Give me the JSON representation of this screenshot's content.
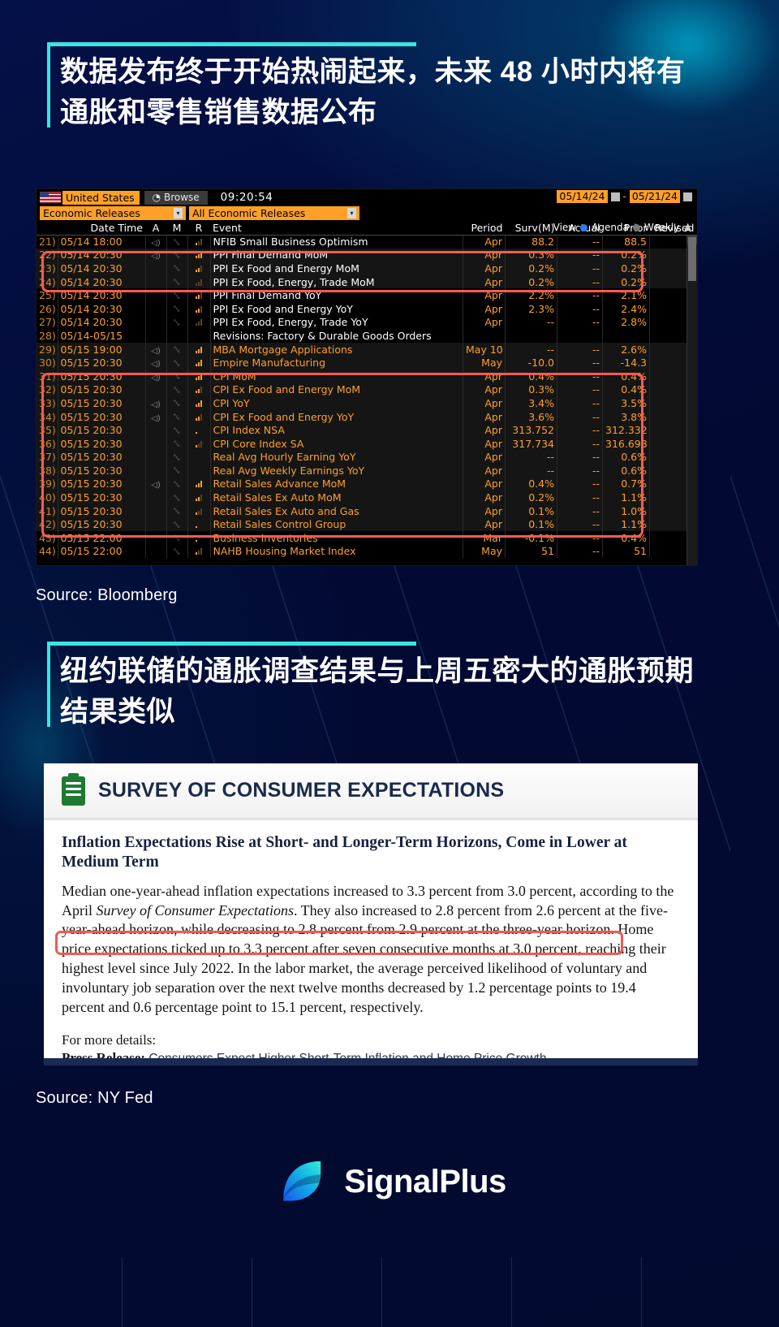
{
  "headlines": {
    "first": "数据发布终于开始热闹起来，未来 48 小时内将有通胀和零售销售数据公布",
    "second": "纽约联储的通胀调查结果与上周五密大的通胀预期结果类似"
  },
  "sources": {
    "first": "Source: Bloomberg",
    "second": "Source: NY Fed"
  },
  "bloomberg": {
    "country": "United States",
    "browse_label": "Browse",
    "clock": "09:20:54",
    "select_left": "Economic Releases",
    "select_right": "All Economic Releases",
    "date_from": "05/14/24",
    "date_to": "05/21/24",
    "date_separator": "-",
    "view_label": "View",
    "agenda_label": "Agenda",
    "weekly_label": "Weekly",
    "columns": {
      "date_time": "Date Time",
      "a": "A",
      "m": "M",
      "r": "R",
      "event": "Event",
      "period": "Period",
      "survey": "Surv(M)",
      "actual": "Actual",
      "prior": "Prior",
      "revised": "Revised"
    },
    "rows": [
      {
        "idx": "21)",
        "dt": "05/14 18:00",
        "a": true,
        "m": true,
        "r": "l1",
        "event": "NFIB Small Business Optimism",
        "color": "white",
        "period": "Apr",
        "surv": "88.2",
        "actual": "--",
        "prior": "88.5",
        "revised": "--",
        "alt": false
      },
      {
        "idx": "22)",
        "dt": "05/14 20:30",
        "a": true,
        "m": true,
        "r": "l3",
        "event": "PPI Final Demand MoM",
        "color": "white",
        "period": "Apr",
        "surv": "0.3%",
        "actual": "--",
        "prior": "0.2%",
        "revised": "--",
        "alt": true
      },
      {
        "idx": "23)",
        "dt": "05/14 20:30",
        "a": false,
        "m": true,
        "r": "l2",
        "event": "PPI Ex Food and Energy MoM",
        "color": "white",
        "period": "Apr",
        "surv": "0.2%",
        "actual": "--",
        "prior": "0.2%",
        "revised": "--",
        "alt": true
      },
      {
        "idx": "24)",
        "dt": "05/14 20:30",
        "a": false,
        "m": true,
        "r": "l0",
        "event": "PPI Ex Food, Energy, Trade MoM",
        "color": "white",
        "period": "Apr",
        "surv": "0.2%",
        "actual": "--",
        "prior": "0.2%",
        "revised": "--",
        "alt": true
      },
      {
        "idx": "25)",
        "dt": "05/14 20:30",
        "a": false,
        "m": true,
        "r": "l2",
        "event": "PPI Final Demand YoY",
        "color": "white",
        "period": "Apr",
        "surv": "2.2%",
        "actual": "--",
        "prior": "2.1%",
        "revised": "--",
        "alt": false
      },
      {
        "idx": "26)",
        "dt": "05/14 20:30",
        "a": false,
        "m": true,
        "r": "l2",
        "event": "PPI Ex Food and Energy YoY",
        "color": "white",
        "period": "Apr",
        "surv": "2.3%",
        "actual": "--",
        "prior": "2.4%",
        "revised": "--",
        "alt": false
      },
      {
        "idx": "27)",
        "dt": "05/14 20:30",
        "a": false,
        "m": true,
        "r": "l0",
        "event": "PPI Ex Food, Energy, Trade YoY",
        "color": "white",
        "period": "Apr",
        "surv": "--",
        "actual": "--",
        "prior": "2.8%",
        "revised": "--",
        "alt": false
      },
      {
        "idx": "28)",
        "dt": "05/14-05/15",
        "a": false,
        "m": false,
        "r": "",
        "event": "Revisions: Factory & Durable Goods Orders",
        "color": "white",
        "period": "",
        "surv": "",
        "actual": "",
        "prior": "",
        "revised": "",
        "alt": false
      },
      {
        "idx": "29)",
        "dt": "05/15 19:00",
        "a": true,
        "m": true,
        "r": "l3",
        "event": "MBA Mortgage Applications",
        "color": "orange",
        "period": "May 10",
        "surv": "--",
        "actual": "--",
        "prior": "2.6%",
        "revised": "--",
        "alt": true
      },
      {
        "idx": "30)",
        "dt": "05/15 20:30",
        "a": true,
        "m": true,
        "r": "l3",
        "event": "Empire Manufacturing",
        "color": "orange",
        "period": "May",
        "surv": "-10.0",
        "actual": "--",
        "prior": "-14.3",
        "revised": "--",
        "alt": true
      },
      {
        "idx": "31)",
        "dt": "05/15 20:30",
        "a": true,
        "m": true,
        "r": "l3",
        "event": "CPI MoM",
        "color": "orange",
        "period": "Apr",
        "surv": "0.4%",
        "actual": "--",
        "prior": "0.4%",
        "revised": "--",
        "alt": true
      },
      {
        "idx": "32)",
        "dt": "05/15 20:30",
        "a": false,
        "m": true,
        "r": "l2",
        "event": "CPI Ex Food and Energy MoM",
        "color": "orange",
        "period": "Apr",
        "surv": "0.3%",
        "actual": "--",
        "prior": "0.4%",
        "revised": "--",
        "alt": true
      },
      {
        "idx": "33)",
        "dt": "05/15 20:30",
        "a": true,
        "m": true,
        "r": "l3",
        "event": "CPI YoY",
        "color": "orange",
        "period": "Apr",
        "surv": "3.4%",
        "actual": "--",
        "prior": "3.5%",
        "revised": "--",
        "alt": true
      },
      {
        "idx": "34)",
        "dt": "05/15 20:30",
        "a": true,
        "m": true,
        "r": "l2",
        "event": "CPI Ex Food and Energy YoY",
        "color": "orange",
        "period": "Apr",
        "surv": "3.6%",
        "actual": "--",
        "prior": "3.8%",
        "revised": "--",
        "alt": true
      },
      {
        "idx": "35)",
        "dt": "05/15 20:30",
        "a": false,
        "m": true,
        "r": "dot",
        "event": "CPI Index NSA",
        "color": "orange",
        "period": "Apr",
        "surv": "313.752",
        "actual": "--",
        "prior": "312.332",
        "revised": "--",
        "alt": true
      },
      {
        "idx": "36)",
        "dt": "05/15 20:30",
        "a": false,
        "m": true,
        "r": "l1",
        "event": "CPI Core Index SA",
        "color": "orange",
        "period": "Apr",
        "surv": "317.734",
        "actual": "--",
        "prior": "316.698",
        "revised": "--",
        "alt": true
      },
      {
        "idx": "37)",
        "dt": "05/15 20:30",
        "a": false,
        "m": true,
        "r": "",
        "event": "Real Avg Hourly Earning YoY",
        "color": "orange",
        "period": "Apr",
        "surv": "--",
        "actual": "--",
        "prior": "0.6%",
        "revised": "--",
        "alt": true
      },
      {
        "idx": "38)",
        "dt": "05/15 20:30",
        "a": false,
        "m": true,
        "r": "",
        "event": "Real Avg Weekly Earnings YoY",
        "color": "orange",
        "period": "Apr",
        "surv": "--",
        "actual": "--",
        "prior": "0.6%",
        "revised": "--",
        "alt": true
      },
      {
        "idx": "39)",
        "dt": "05/15 20:30",
        "a": true,
        "m": true,
        "r": "l3",
        "event": "Retail Sales Advance MoM",
        "color": "orange",
        "period": "Apr",
        "surv": "0.4%",
        "actual": "--",
        "prior": "0.7%",
        "revised": "--",
        "alt": true
      },
      {
        "idx": "40)",
        "dt": "05/15 20:30",
        "a": false,
        "m": true,
        "r": "l2",
        "event": "Retail Sales Ex Auto MoM",
        "color": "orange",
        "period": "Apr",
        "surv": "0.2%",
        "actual": "--",
        "prior": "1.1%",
        "revised": "--",
        "alt": true
      },
      {
        "idx": "41)",
        "dt": "05/15 20:30",
        "a": false,
        "m": true,
        "r": "l1",
        "event": "Retail Sales Ex Auto and Gas",
        "color": "orange",
        "period": "Apr",
        "surv": "0.1%",
        "actual": "--",
        "prior": "1.0%",
        "revised": "--",
        "alt": true
      },
      {
        "idx": "42)",
        "dt": "05/15 20:30",
        "a": false,
        "m": true,
        "r": "dot",
        "event": "Retail Sales Control Group",
        "color": "orange",
        "period": "Apr",
        "surv": "0.1%",
        "actual": "--",
        "prior": "1.1%",
        "revised": "--",
        "alt": true
      },
      {
        "idx": "43)",
        "dt": "05/15 22:00",
        "a": false,
        "m": true,
        "r": "dot",
        "event": "Business Inventories",
        "color": "orange",
        "period": "Mar",
        "surv": "-0.1%",
        "actual": "--",
        "prior": "0.4%",
        "revised": "--",
        "alt": false
      },
      {
        "idx": "44)",
        "dt": "05/15 22:00",
        "a": false,
        "m": true,
        "r": "l1",
        "event": "NAHB Housing Market Index",
        "color": "orange",
        "period": "May",
        "surv": "51",
        "actual": "--",
        "prior": "51",
        "revised": "--",
        "alt": false
      }
    ]
  },
  "nyfed": {
    "doc_title": "SURVEY OF CONSUMER EXPECTATIONS",
    "subtitle": "Inflation Expectations Rise at Short- and Longer-Term Horizons, Come in Lower at Medium Term",
    "paragraph": "Median one-year-ahead inflation expectations increased to 3.3 percent from 3.0 percent, according to the April Survey of Consumer Expectations. They also increased to 2.8 percent from 2.6 percent at the five-year-ahead horizon, while decreasing to 2.8 percent from 2.9 percent at the three-year horizon. Home price expectations ticked up to 3.3 percent after seven consecutive months at 3.0 percent, reaching their highest level since July 2022. In the labor market, the average perceived likelihood of voluntary and involuntary job separation over the next twelve months decreased by 1.2 percentage points to 19.4 percent and 0.6 percentage point to 15.1 percent, respectively.",
    "more_details": "For more details:",
    "press_release_label": "Press Release:",
    "press_release_title": "Consumers Expect Higher Short-Term Inflation and Home Price Growth"
  },
  "brand": {
    "name": "SignalPlus"
  },
  "colors": {
    "accent": "#35e7e0",
    "highlight": "#ff5a52",
    "bloomberg_orange": "#ffa028",
    "background": "#030b38"
  }
}
